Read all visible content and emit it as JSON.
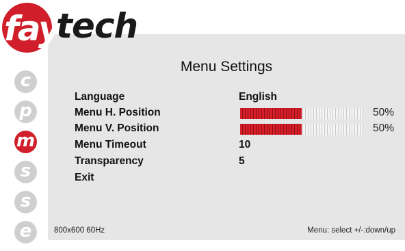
{
  "brand": {
    "name_part1": "fay",
    "name_part2": "tech",
    "accent_color": "#d01f2a"
  },
  "sidebar": {
    "icons": [
      {
        "letter": "c",
        "icon": "c-circle-icon",
        "active": false
      },
      {
        "letter": "p",
        "icon": "p-circle-icon",
        "active": false
      },
      {
        "letter": "m",
        "icon": "m-circle-icon",
        "active": true
      },
      {
        "letter": "s",
        "icon": "s-circle-icon",
        "active": false
      },
      {
        "letter": "s",
        "icon": "s-circle-icon",
        "active": false
      },
      {
        "letter": "e",
        "icon": "e-circle-icon",
        "active": false
      }
    ]
  },
  "menu": {
    "title": "Menu Settings",
    "items": [
      {
        "label": "Language",
        "value": "English"
      },
      {
        "label": "Menu H. Position",
        "level_percent": 50,
        "value_text": "50%"
      },
      {
        "label": "Menu V. Position",
        "level_percent": 50,
        "value_text": "50%"
      },
      {
        "label": "Menu Timeout",
        "value": "10"
      },
      {
        "label": "Transparency",
        "value": "5"
      },
      {
        "label": "Exit"
      }
    ]
  },
  "footer": {
    "resolution": "800x600 60Hz",
    "hint": "Menu: select +/-:down/up"
  }
}
